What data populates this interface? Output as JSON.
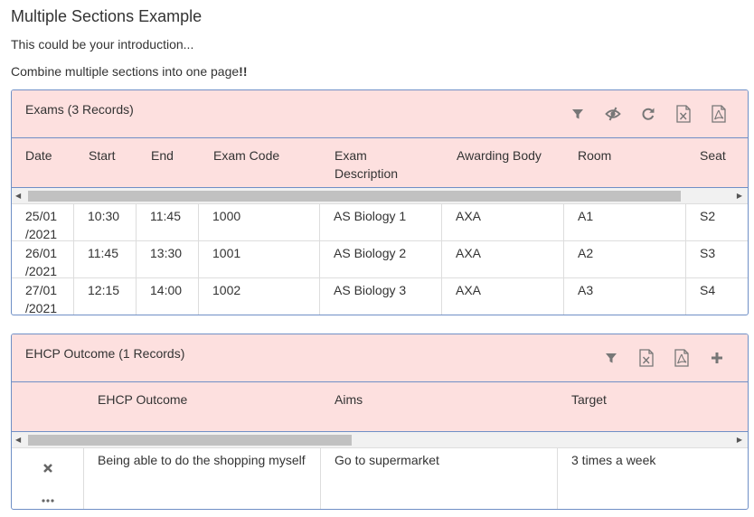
{
  "page": {
    "title": "Multiple Sections Example",
    "intro": "This could be your introduction...",
    "combine_text": "Combine multiple sections into one page",
    "combine_emph": "!!"
  },
  "exams": {
    "title": "Exams (3 Records)",
    "headers": [
      "Date",
      "Start",
      "End",
      "Exam Code",
      "Exam Description",
      "Awarding Body",
      "Room",
      "Seat"
    ],
    "rows": [
      [
        "25/01 /2021",
        "10:30",
        "11:45",
        "1000",
        "AS Biology 1",
        "AXA",
        "A1",
        "S2"
      ],
      [
        "26/01 /2021",
        "11:45",
        "13:30",
        "1001",
        "AS Biology 2",
        "AXA",
        "A2",
        "S3"
      ],
      [
        "27/01 /2021",
        "12:15",
        "14:00",
        "1002",
        "AS Biology 3",
        "AXA",
        "A3",
        "S4"
      ]
    ],
    "tools": [
      "filter-icon",
      "eye-slash-icon",
      "refresh-icon",
      "excel-export-icon",
      "pdf-export-icon"
    ]
  },
  "ehcp": {
    "title": "EHCP Outcome (1 Records)",
    "headers": [
      "EHCP Outcome",
      "Aims",
      "Target"
    ],
    "rows": [
      [
        "Being able to do the shopping myself",
        "Go to supermarket",
        "3 times a week"
      ]
    ],
    "tools": [
      "filter-icon",
      "excel-export-icon",
      "pdf-export-icon",
      "add-icon"
    ],
    "row_actions": [
      "delete-icon",
      "more-icon"
    ]
  },
  "colors": {
    "panel_header_bg": "#fde0df",
    "panel_border": "#6f8fc6",
    "icon_gray": "#777777"
  }
}
